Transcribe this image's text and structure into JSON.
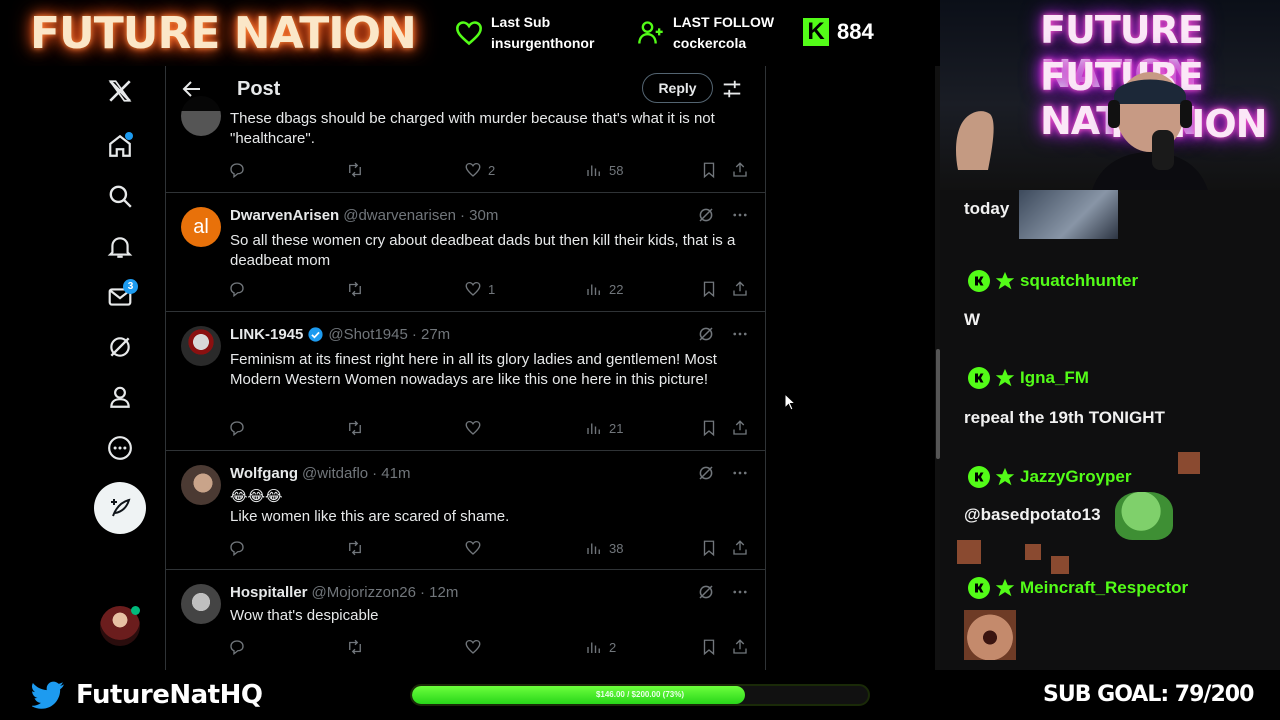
{
  "stream": {
    "brand": "FUTURE NATION",
    "last_sub_label": "Last Sub",
    "last_sub_user": "insurgenthonor",
    "last_follow_label": "LAST FOLLOW",
    "last_follow_user": "cockercola",
    "kick_count": "884",
    "kick_letter": "K",
    "cam_neon_1": "FUTURE NATION",
    "cam_neon_2": "FUTURE NATION",
    "cam_neon_3": "NATION",
    "twitter_handle": "FutureNatHQ",
    "progress_text": "$146.00 / $200.00 (73%)",
    "progress_fraction": 0.73,
    "sub_goal": "SUB GOAL: 79/200"
  },
  "x": {
    "nav": {
      "messages_badge": "3",
      "icons": [
        "x-logo-icon",
        "home-icon",
        "search-icon",
        "notifications-icon",
        "messages-icon",
        "grok-icon",
        "profile-icon",
        "more-icon"
      ]
    },
    "header": {
      "title": "Post",
      "reply_label": "Reply"
    },
    "tweets": [
      {
        "name": "",
        "handle": "",
        "time": "",
        "text": "These dbags should be charged with murder because that's what it is not \"healthcare\".",
        "replies": "",
        "retweets": "",
        "likes": "2",
        "views": "58"
      },
      {
        "name": "DwarvenArisen",
        "handle": "@dwarvenarisen",
        "time": "· 30m",
        "avatar_text": "al",
        "text": "So all these women cry about deadbeat dads but then kill their kids, that is a deadbeat mom",
        "likes": "1",
        "views": "22"
      },
      {
        "name": "LINK-1945",
        "handle": "@Shot1945",
        "time": "· 27m",
        "text": "Feminism at its finest right here in all its glory ladies and gentlemen! Most Modern Western Women nowadays are like this one here in this picture!",
        "likes": "",
        "views": "21"
      },
      {
        "name": "Wolfgang",
        "handle": "@witdaflo",
        "time": "· 41m",
        "text_emoji": "😂😂😂",
        "text": "Like women like this are scared of shame.",
        "likes": "",
        "views": "38"
      },
      {
        "name": "Hospitaller",
        "handle": "@Mojorizzon26",
        "time": "· 12m",
        "text": "Wow that's despicable",
        "likes": "",
        "views": "2"
      }
    ]
  },
  "chat": [
    {
      "type": "text",
      "text": "today"
    },
    {
      "type": "user",
      "name": "squatchhunter"
    },
    {
      "type": "text",
      "text": "W"
    },
    {
      "type": "user",
      "name": "Igna_FM"
    },
    {
      "type": "text",
      "text": "repeal the 19th TONIGHT"
    },
    {
      "type": "user",
      "name": "JazzyGroyper"
    },
    {
      "type": "text",
      "text": "@basedpotato13"
    },
    {
      "type": "user",
      "name": "Meincraft_Respector"
    }
  ],
  "colors": {
    "kick_green": "#53fc18",
    "x_blue": "#1d9bf0",
    "x_muted": "#71767b",
    "x_border": "#2f3336"
  }
}
